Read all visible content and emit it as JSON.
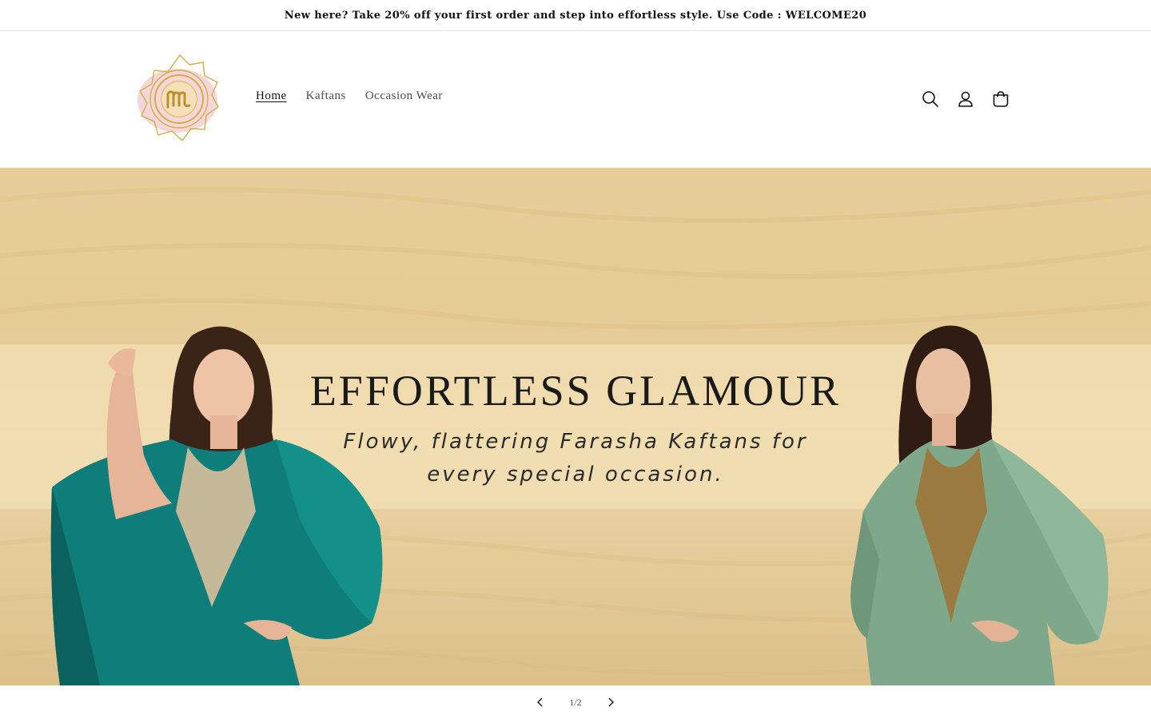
{
  "announcement": {
    "text": "New here? Take 20% off your first order and step into effortless style. Use Code : WELCOME20"
  },
  "header": {
    "logo_icon": "mandala-logo-icon",
    "nav": [
      {
        "label": "Home",
        "active": true
      },
      {
        "label": "Kaftans",
        "active": false
      },
      {
        "label": "Occasion Wear",
        "active": false
      }
    ],
    "icons": {
      "search": "search-icon",
      "account": "account-icon",
      "cart": "cart-icon"
    }
  },
  "hero": {
    "title": "EFFORTLESS GLAMOUR",
    "subtitle_line1": "Flowy, flattering Farasha Kaftans for",
    "subtitle_line2": "every special occasion."
  },
  "slider": {
    "counter": "1/2",
    "current": 1,
    "total": 2
  },
  "colors": {
    "sand": "#e6cc98",
    "teal_kaftan": "#0f7d79",
    "sage_kaftan": "#7fa88b",
    "logo_gold": "#d4ad4a",
    "logo_pink": "#efc5c9"
  }
}
